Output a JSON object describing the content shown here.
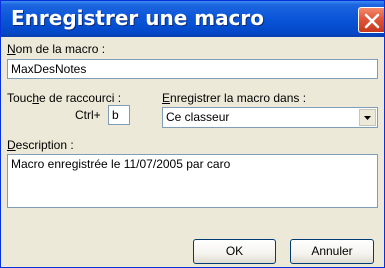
{
  "dialog": {
    "title": "Enregistrer une macro",
    "macro_name": {
      "label_underlined": "N",
      "label_rest": "om de la macro :",
      "value": "MaxDesNotes"
    },
    "shortcut": {
      "label_pre": "Touc",
      "label_underlined": "h",
      "label_post": "e de raccourci :",
      "prefix": "Ctrl+",
      "value": "b"
    },
    "store_in": {
      "label_underlined": "E",
      "label_rest": "nregistrer la macro dans :",
      "selected": "Ce classeur"
    },
    "description": {
      "label_underlined": "D",
      "label_rest": "escription :",
      "value": "Macro enregistrée le 11/07/2005 par caro"
    },
    "buttons": {
      "ok": "OK",
      "cancel": "Annuler"
    }
  }
}
